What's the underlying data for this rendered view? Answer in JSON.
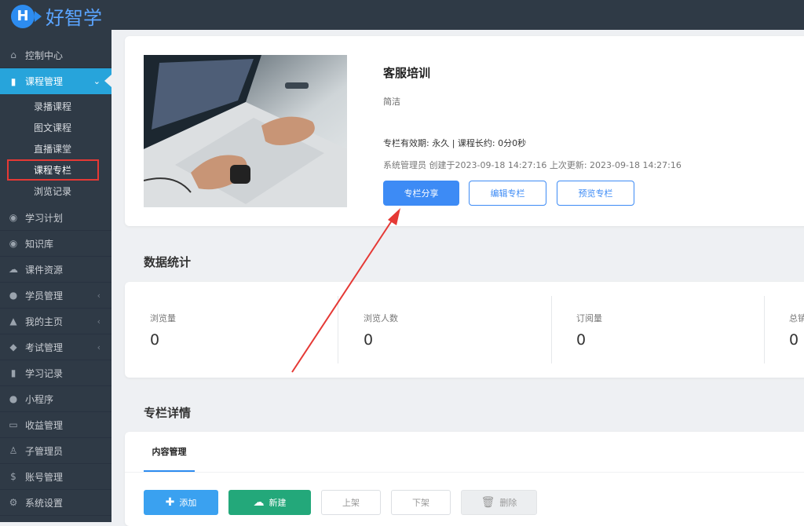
{
  "brand": {
    "logo_letter": "H",
    "name": "好智学",
    "accent": "#2d8cf0"
  },
  "sidebar": {
    "items": [
      {
        "label": "控制中心",
        "icon": "home-icon"
      },
      {
        "label": "课程管理",
        "icon": "book-icon",
        "active": true,
        "expanded": true
      },
      {
        "label": "学习计划",
        "icon": "eye-icon"
      },
      {
        "label": "知识库",
        "icon": "eye-icon"
      },
      {
        "label": "课件资源",
        "icon": "cloud-icon"
      },
      {
        "label": "学员管理",
        "icon": "users-icon",
        "has_children": true
      },
      {
        "label": "我的主页",
        "icon": "graduation-cap-icon",
        "has_children": true
      },
      {
        "label": "考试管理",
        "icon": "tag-icon",
        "has_children": true
      },
      {
        "label": "学习记录",
        "icon": "book-icon"
      },
      {
        "label": "小程序",
        "icon": "wechat-icon"
      },
      {
        "label": "收益管理",
        "icon": "credit-card-icon"
      },
      {
        "label": "子管理员",
        "icon": "user-lock-icon"
      },
      {
        "label": "账号管理",
        "icon": "dollar-icon"
      },
      {
        "label": "系统设置",
        "icon": "gear-icon"
      }
    ],
    "course_submenu": [
      "录播课程",
      "图文课程",
      "直播课堂",
      "课程专栏",
      "浏览记录"
    ],
    "selected_submenu": "课程专栏"
  },
  "column": {
    "title": "客服培训",
    "description": "简洁",
    "validity": "专栏有效期: 永久 | 课程长约: 0分0秒",
    "author_line": "系统管理员 创建于2023-09-18 14:27:16 上次更新: 2023-09-18 14:27:16",
    "share_button": "专栏分享",
    "edit_button": "编辑专栏",
    "preview_button": "预览专栏"
  },
  "stats": {
    "section_title": "数据统计",
    "items": [
      {
        "label": "浏览量",
        "value": "0"
      },
      {
        "label": "浏览人数",
        "value": "0"
      },
      {
        "label": "订阅量",
        "value": "0"
      },
      {
        "label": "总销",
        "value": "0"
      }
    ]
  },
  "detail": {
    "section_title": "专栏详情",
    "tab": "内容管理",
    "buttons": {
      "add": "添加",
      "new": "新建",
      "up": "上架",
      "down": "下架",
      "delete": "删除"
    }
  },
  "annotation_color": "#e53935"
}
